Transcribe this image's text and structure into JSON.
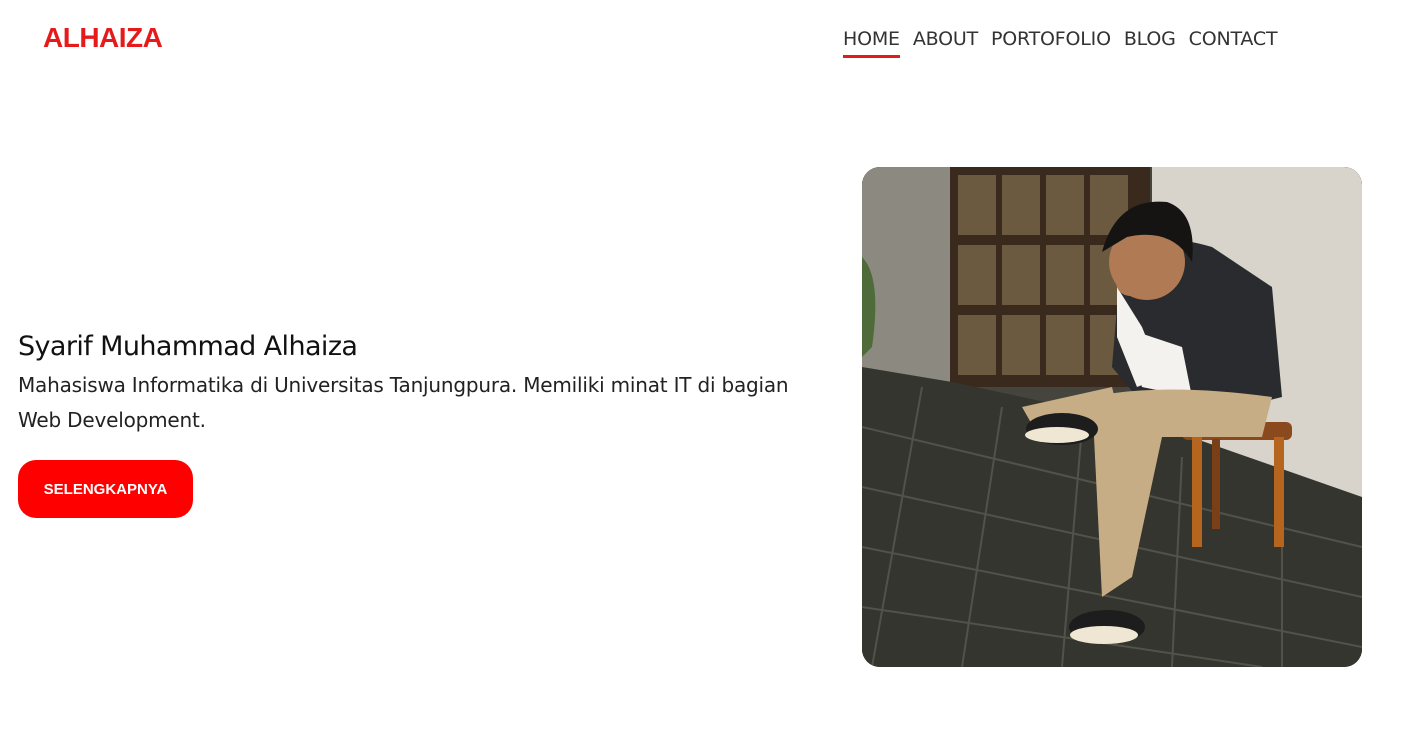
{
  "header": {
    "logo": "ALHAIZA",
    "nav": [
      {
        "label": "HOME",
        "active": true
      },
      {
        "label": "ABOUT",
        "active": false
      },
      {
        "label": "PORTOFOLIO",
        "active": false
      },
      {
        "label": "BLOG",
        "active": false
      },
      {
        "label": "CONTACT",
        "active": false
      }
    ]
  },
  "hero": {
    "name": "Syarif Muhammad Alhaiza",
    "description": "Mahasiswa Informatika di Universitas Tanjungpura. Memiliki minat IT di bagian Web Development.",
    "button_label": "SELENGKAPNYA",
    "photo_alt": "profile-photo"
  },
  "colors": {
    "accent": "#ff0000",
    "logo": "#e51b1b",
    "text": "#111111"
  }
}
